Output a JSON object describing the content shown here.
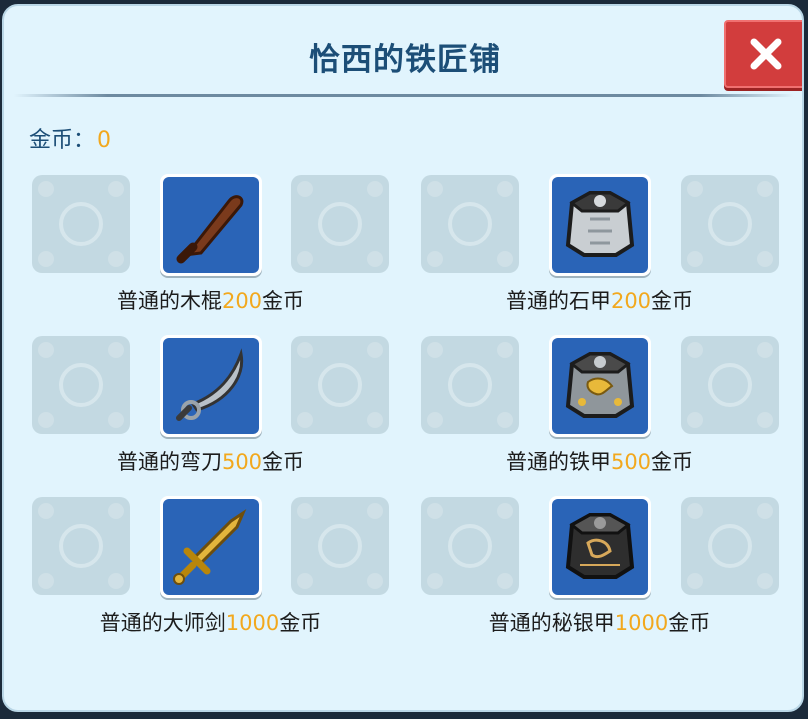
{
  "shop": {
    "title": "恰西的铁匠铺",
    "close_icon": "close-x-icon"
  },
  "wallet": {
    "label": "金币：",
    "amount": "0"
  },
  "currency": "金币",
  "colors": {
    "title": "#1c4e77",
    "price": "#f2a81d",
    "item_bg": "#2a64b7",
    "close_bg": "#d23d3d"
  },
  "items": [
    {
      "name": "普通的木棍",
      "price": "200",
      "icon": "wooden-club-icon"
    },
    {
      "name": "普通的石甲",
      "price": "200",
      "icon": "stone-armor-icon"
    },
    {
      "name": "普通的弯刀",
      "price": "500",
      "icon": "scimitar-icon"
    },
    {
      "name": "普通的铁甲",
      "price": "500",
      "icon": "iron-armor-icon"
    },
    {
      "name": "普通的大师剑",
      "price": "1000",
      "icon": "master-sword-icon"
    },
    {
      "name": "普通的秘银甲",
      "price": "1000",
      "icon": "mithril-armor-icon"
    }
  ]
}
